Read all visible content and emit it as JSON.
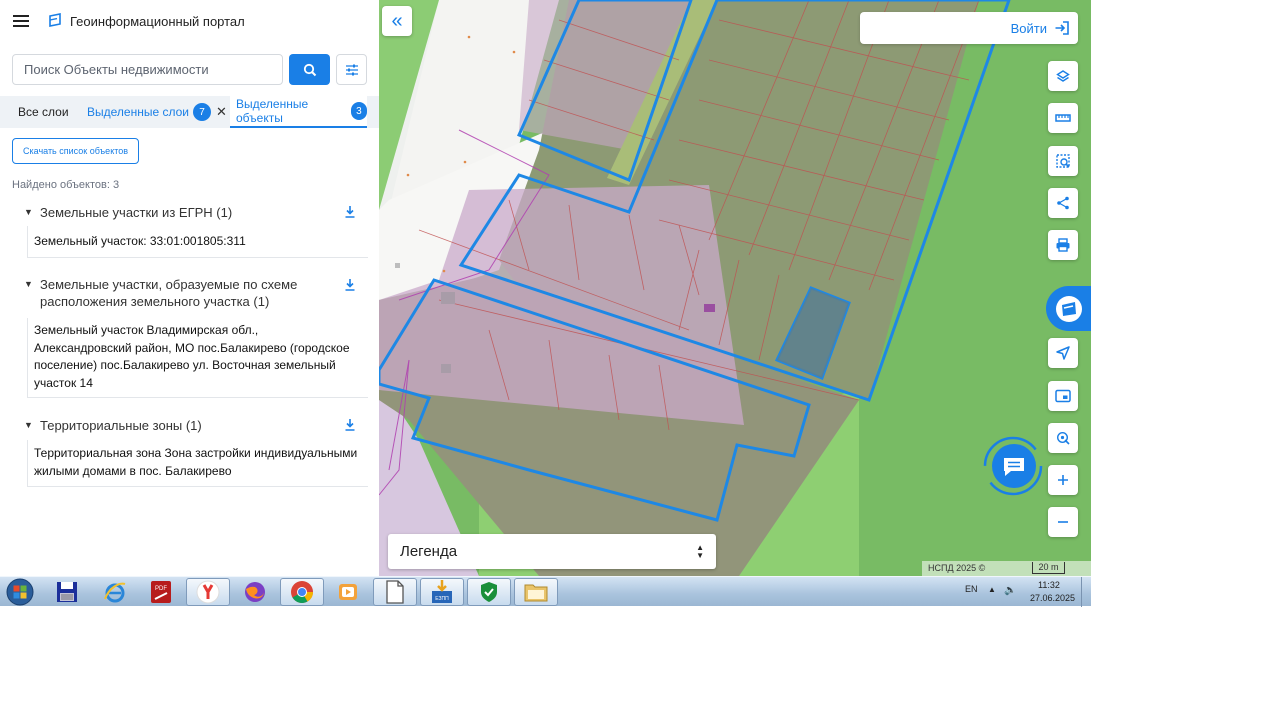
{
  "header": {
    "app_title": "Геоинформационный портал"
  },
  "search": {
    "placeholder": "Поиск Объекты недвижимости"
  },
  "tabs": [
    {
      "label": "Все слои"
    },
    {
      "label": "Выделенные слои",
      "badge": "7"
    },
    {
      "label": "Выделенные объекты",
      "badge": "3"
    }
  ],
  "results": {
    "download_list_label": "Скачать список объектов",
    "found_label": "Найдено объектов: 3",
    "groups": [
      {
        "title": "Земельные участки из ЕГРН (1)",
        "items": [
          "Земельный участок: 33:01:001805:311"
        ]
      },
      {
        "title_lines": [
          "Земельные участки, образуемые по схеме",
          "расположения земельного участка (1)"
        ],
        "items_lines": [
          "Земельный участок Владимирская обл.,",
          "Александровский район, МО пос.Балакирево (городское",
          "поселение) пос.Балакирево ул. Восточная земельный",
          "участок 14"
        ]
      },
      {
        "title": "Территориальные зоны (1)",
        "items_lines": [
          "Территориальная зона Зона застройки индивидуальными",
          "жилыми домами в пос. Балакирево"
        ]
      }
    ]
  },
  "map": {
    "login_label": "Войти",
    "legend_label": "Легенда",
    "copyright": "НСПД 2025 ©",
    "scale_label": "20 m",
    "tools": [
      "layers-icon",
      "ruler-icon",
      "select-area-icon",
      "share-icon",
      "print-icon",
      "geo-logo-icon",
      "navigate-icon",
      "minimap-icon",
      "location-icon",
      "zoom-in-icon",
      "zoom-out-icon"
    ]
  },
  "taskbar": {
    "apps": [
      "file-manager-icon",
      "internet-explorer-icon",
      "pdf-icon",
      "yandex-browser-icon",
      "firefox-icon",
      "chrome-icon",
      "media-player-icon",
      "document-icon",
      "eshp-icon",
      "shield-icon",
      "folder-icon"
    ],
    "eshp_label": "ЕЗПП",
    "lang": "EN",
    "time": "11:32",
    "date": "27.06.2025"
  },
  "colors": {
    "accent": "#1a7fe6",
    "parcel_outline": "#1e88e5",
    "zone_fill": "#c9a9c9",
    "grass": "#78bb64"
  }
}
